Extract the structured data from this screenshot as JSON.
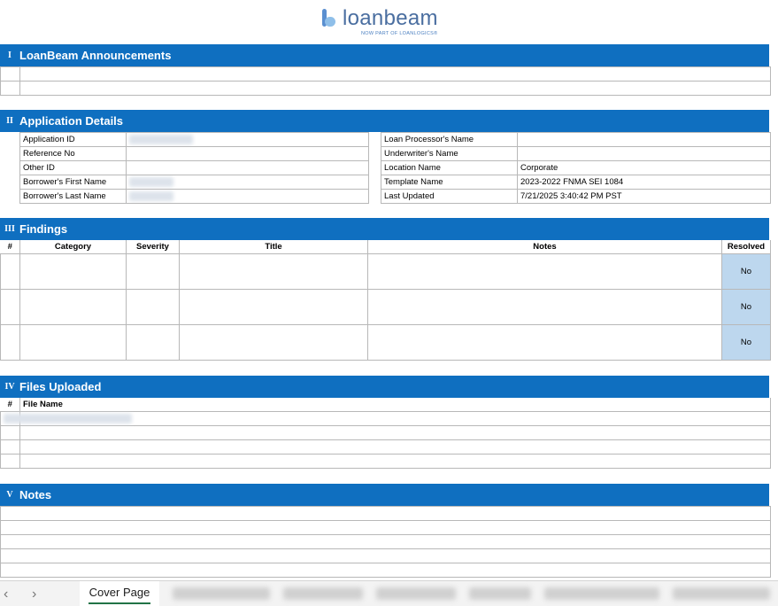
{
  "logo": {
    "brand": "loanbeam",
    "tagline": "NOW PART OF LOANLOGICS®"
  },
  "sections": {
    "announcements": {
      "num": "I",
      "title": "LoanBeam Announcements"
    },
    "application": {
      "num": "II",
      "title": "Application Details"
    },
    "findings": {
      "num": "III",
      "title": "Findings"
    },
    "files": {
      "num": "IV",
      "title": "Files Uploaded"
    },
    "notes": {
      "num": "V",
      "title": "Notes"
    }
  },
  "application": {
    "left": [
      {
        "label": "Application ID",
        "value": ""
      },
      {
        "label": "Reference No",
        "value": ""
      },
      {
        "label": "Other ID",
        "value": ""
      },
      {
        "label": "Borrower's First Name",
        "value": ""
      },
      {
        "label": "Borrower's Last Name",
        "value": ""
      }
    ],
    "right": [
      {
        "label": "Loan Processor's Name",
        "value": ""
      },
      {
        "label": "Underwriter's Name",
        "value": ""
      },
      {
        "label": "Location Name",
        "value": "Corporate"
      },
      {
        "label": "Template Name",
        "value": "2023-2022 FNMA SEI 1084"
      },
      {
        "label": "Last Updated",
        "value": "7/21/2025 3:40:42 PM PST"
      }
    ]
  },
  "findings": {
    "headers": [
      "#",
      "Category",
      "Severity",
      "Title",
      "Notes",
      "Resolved"
    ],
    "rows": [
      {
        "resolved": "No"
      },
      {
        "resolved": "No"
      },
      {
        "resolved": "No"
      }
    ]
  },
  "files": {
    "headers": [
      "#",
      "File Name"
    ]
  },
  "tabs": {
    "active": "Cover Page",
    "prev_arrow": "‹",
    "next_arrow": "›"
  },
  "colors": {
    "header_blue": "#0f6fc0",
    "resolved_fill": "#bdd7ee",
    "active_tab_underline": "#217346"
  }
}
